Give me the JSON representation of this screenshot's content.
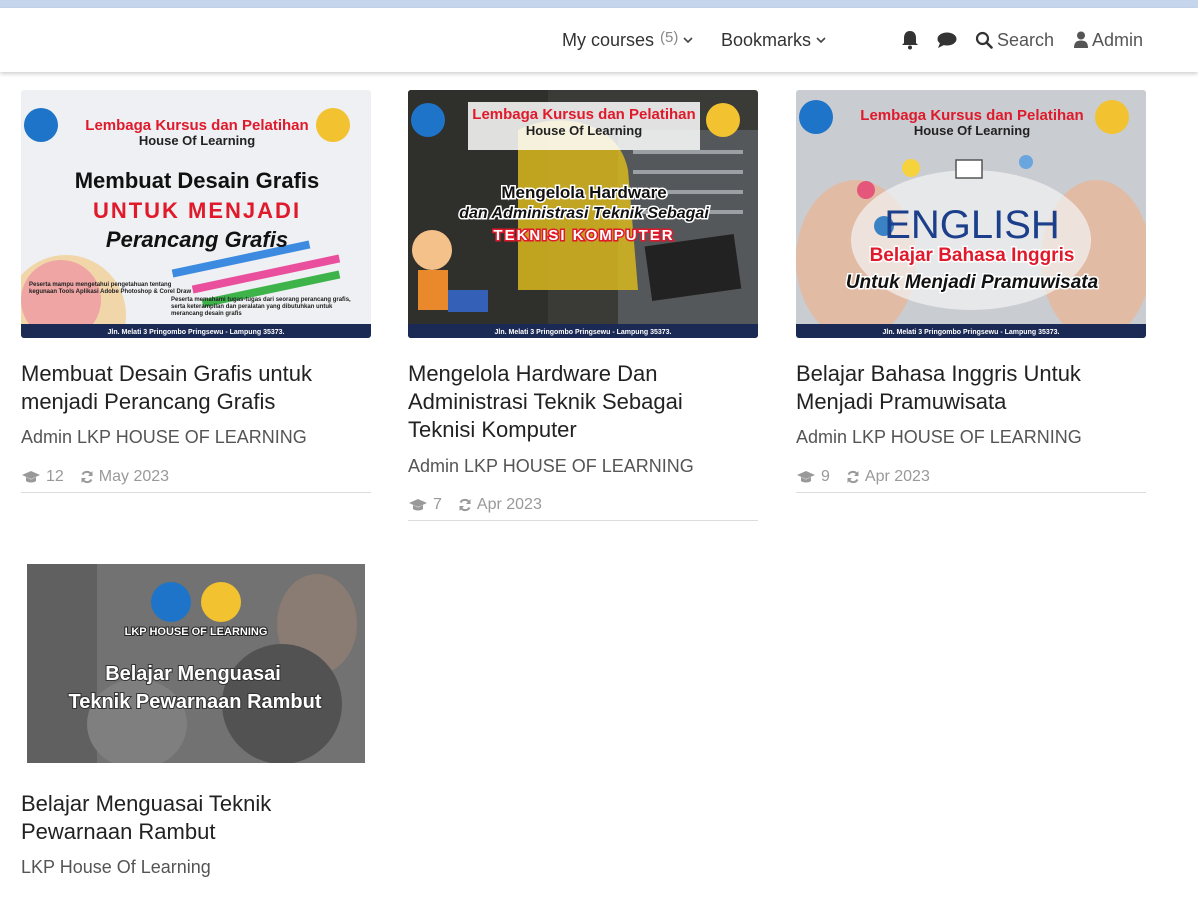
{
  "nav": {
    "my_courses": "My courses",
    "my_courses_count": "(5)",
    "bookmarks": "Bookmarks",
    "search": "Search",
    "user": "Admin"
  },
  "courses": [
    {
      "title_line1": "Membuat Desain Grafis untuk",
      "title_line2": "menjadi Perancang Grafis",
      "title_line3": "",
      "author": "Admin LKP HOUSE OF LEARNING",
      "students": "12",
      "updated": "May 2023",
      "thumb": {
        "header": "Lembaga Kursus dan Pelatihan",
        "sub": "House Of Learning",
        "l1": "Membuat Desain Grafis",
        "l2": "UNTUK MENJADI",
        "l3": "Perancang Grafis",
        "n1": "Peserta mampu mengetahui pengetahuan tentang",
        "n2": "kegunaan Tools Aplikasi Adobe Photoshop & Corel Draw",
        "n3": "Peserta memahami tugas-tugas dari seorang perancang grafis,",
        "n4": "serta keterampilan dan peralatan yang dibutuhkan untuk",
        "n5": "merancang desain grafis",
        "footer": "Jln. Melati 3 Pringombo Pringsewu - Lampung 35373."
      }
    },
    {
      "title_line1": "Mengelola Hardware Dan",
      "title_line2": "Administrasi Teknik Sebagai",
      "title_line3": "Teknisi Komputer",
      "author": "Admin LKP HOUSE OF LEARNING",
      "students": "7",
      "updated": "Apr 2023",
      "thumb": {
        "header": "Lembaga Kursus dan Pelatihan",
        "sub": "House Of Learning",
        "l1": "Mengelola Hardware",
        "l2": "dan Administrasi Teknik Sebagai",
        "l3": "TEKNISI KOMPUTER",
        "footer": "Jln. Melati 3 Pringombo Pringsewu - Lampung 35373."
      }
    },
    {
      "title_line1": "Belajar Bahasa Inggris Untuk",
      "title_line2": "Menjadi Pramuwisata",
      "title_line3": "",
      "author": "Admin LKP HOUSE OF LEARNING",
      "students": "9",
      "updated": "Apr 2023",
      "thumb": {
        "header": "Lembaga Kursus dan Pelatihan",
        "sub": "House Of Learning",
        "l1": "ENGLISH",
        "l2": "Belajar Bahasa Inggris",
        "l3": "Untuk Menjadi Pramuwisata",
        "footer": "Jln. Melati 3 Pringombo Pringsewu - Lampung 35373."
      }
    },
    {
      "title_line1": "Belajar Menguasai Teknik",
      "title_line2": "Pewarnaan Rambut",
      "title_line3": "",
      "author": "LKP House Of Learning",
      "thumb": {
        "header": "LKP HOUSE OF LEARNING",
        "l1": "Belajar Menguasai",
        "l2": "Teknik Pewarnaan Rambut"
      }
    }
  ],
  "colors": {
    "accent_red": "#e0192b",
    "navy": "#1b2a55",
    "meta_grey": "#999999"
  }
}
